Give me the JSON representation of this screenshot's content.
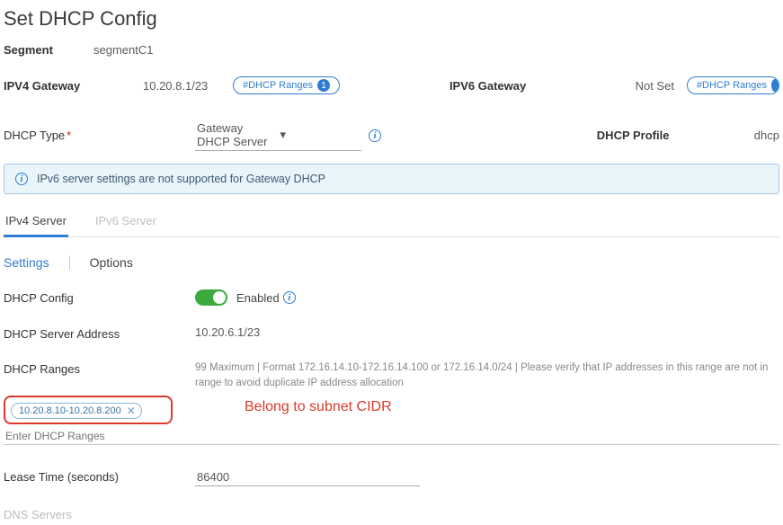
{
  "title": "Set DHCP Config",
  "segment": {
    "label": "Segment",
    "value": "segmentC1"
  },
  "ipv4gw": {
    "label": "IPV4 Gateway",
    "value": "10.20.8.1/23",
    "pill": "#DHCP Ranges",
    "count": "1"
  },
  "ipv6gw": {
    "label": "IPV6 Gateway",
    "value": "Not Set",
    "pill": "#DHCP Ranges"
  },
  "dhcpType": {
    "label": "DHCP Type",
    "value": "Gateway DHCP Server"
  },
  "dhcpProfile": {
    "label": "DHCP Profile",
    "value": "dhcp"
  },
  "banner": "IPv6 server settings are not supported for Gateway DHCP",
  "tabs": {
    "ipv4": "IPv4 Server",
    "ipv6": "IPv6 Server"
  },
  "subtabs": {
    "settings": "Settings",
    "options": "Options"
  },
  "dhcpConfig": {
    "label": "DHCP Config",
    "status": "Enabled"
  },
  "serverAddr": {
    "label": "DHCP Server Address",
    "value": "10.20.6.1/23"
  },
  "ranges": {
    "label": "DHCP Ranges",
    "hint": "99 Maximum | Format 172.16.14.10-172.16.14.100 or 172.16.14.0/24 | Please verify that IP addresses in this range are not in range to avoid duplicate IP address allocation",
    "value": "10.20.8.10-10.20.8.200",
    "placeholder": "Enter DHCP Ranges",
    "annotation": "Belong to subnet CIDR"
  },
  "lease": {
    "label": "Lease Time (seconds)",
    "value": "86400"
  },
  "dns": {
    "label": "DNS Servers"
  }
}
